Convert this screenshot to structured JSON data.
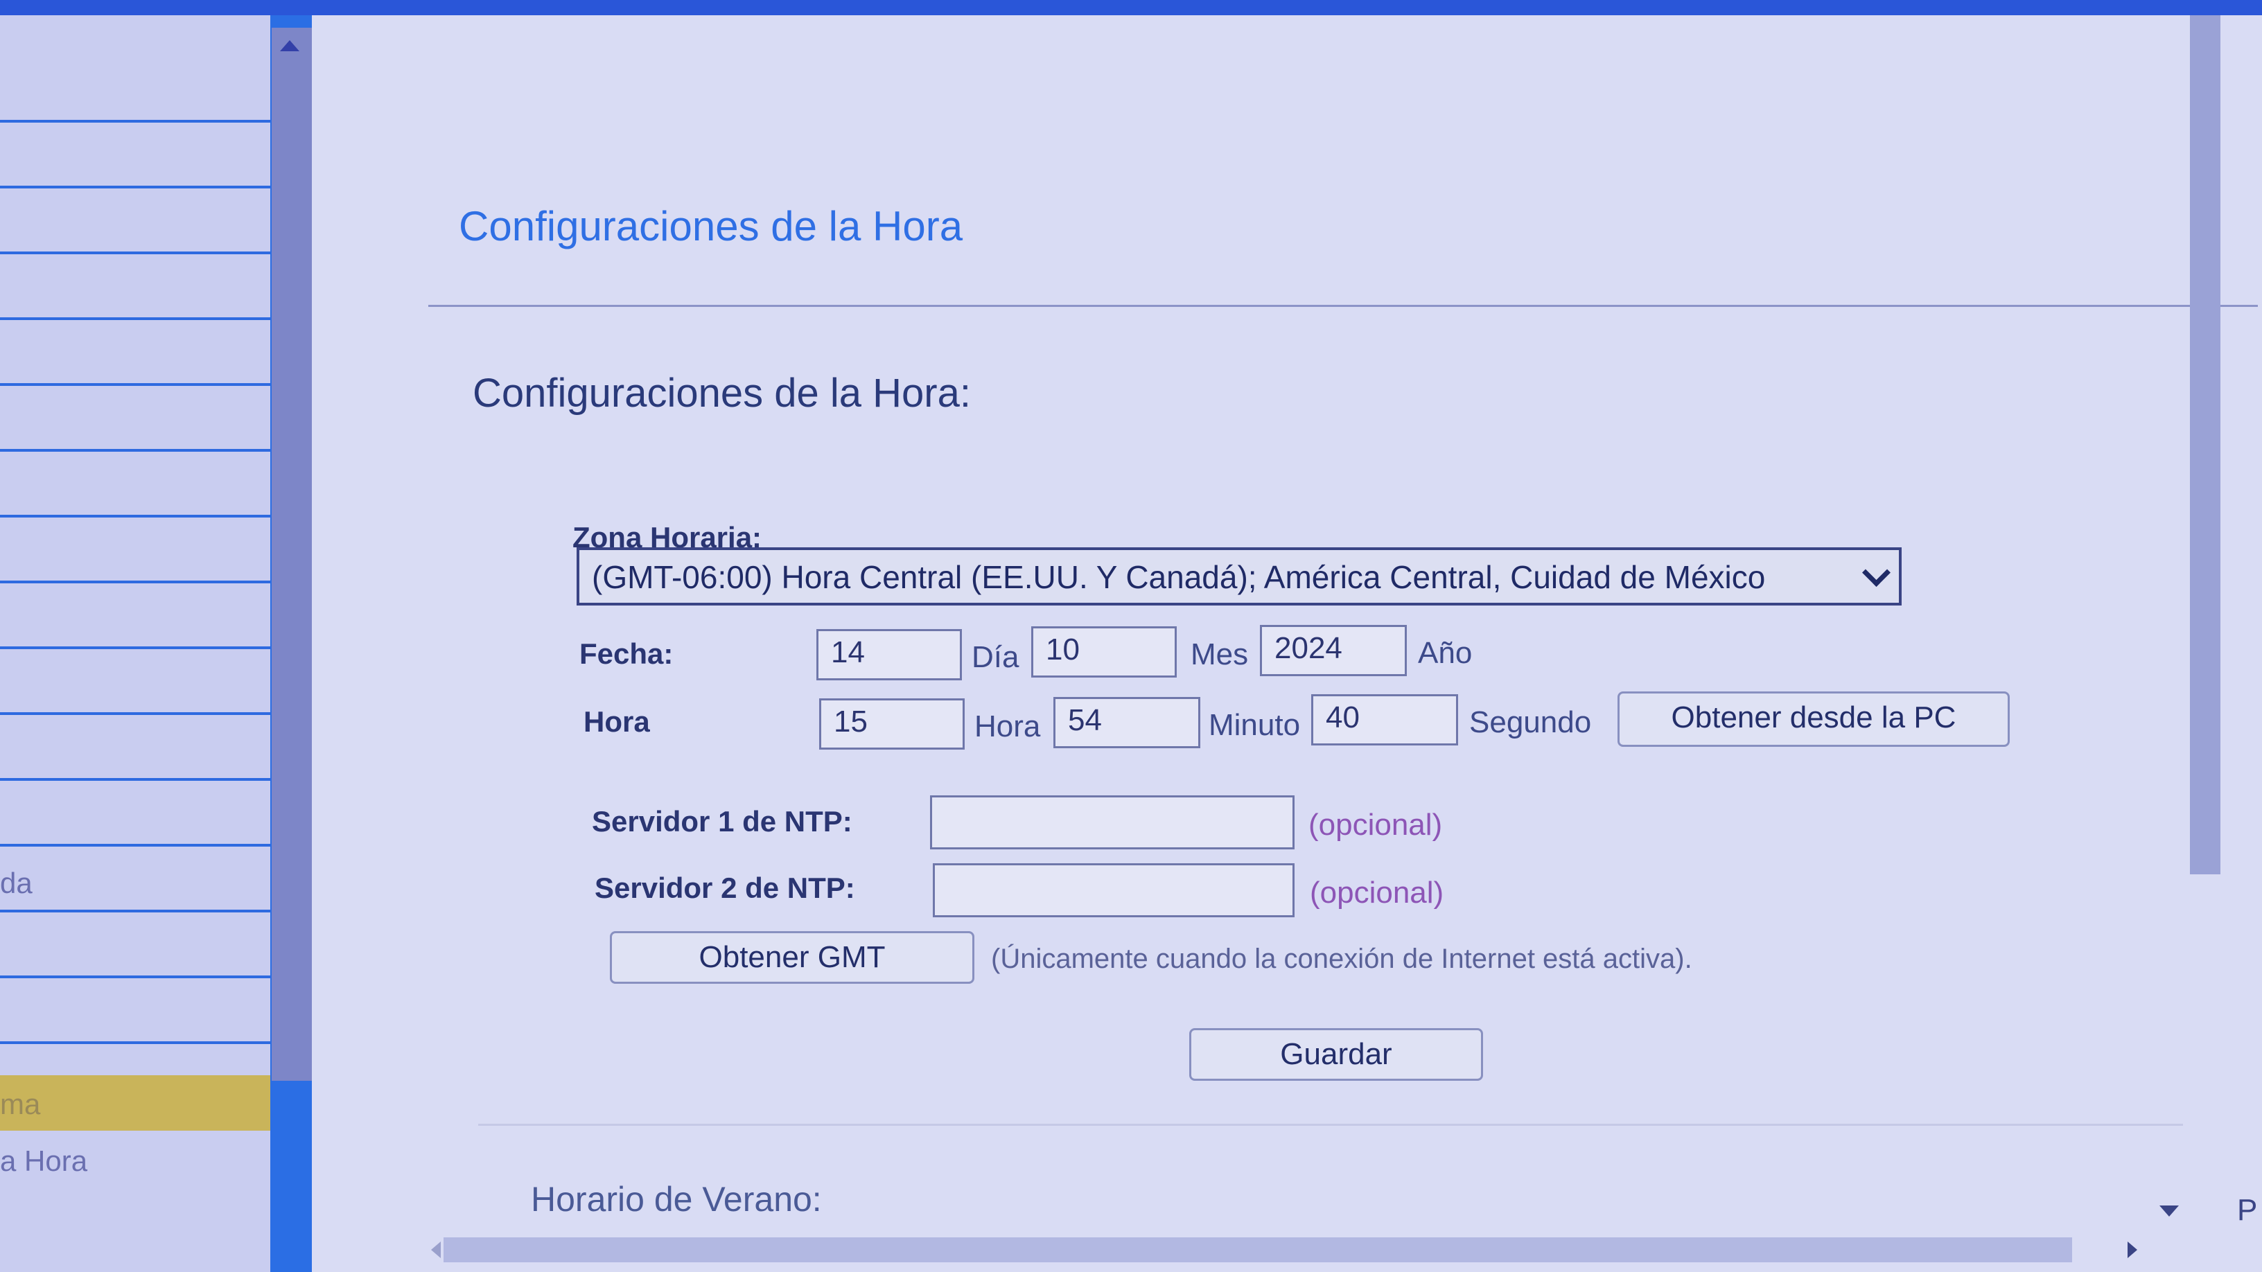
{
  "sidebar": {
    "items": [
      {
        "label": ""
      },
      {
        "label": ""
      },
      {
        "label": ""
      },
      {
        "label": ""
      },
      {
        "label": ""
      },
      {
        "label": ""
      },
      {
        "label": ""
      },
      {
        "label": ""
      },
      {
        "label": ""
      },
      {
        "label": ""
      },
      {
        "label": ""
      },
      {
        "label": ""
      },
      {
        "label": "da"
      },
      {
        "label": ""
      },
      {
        "label": ""
      },
      {
        "label": ""
      },
      {
        "label": "ma"
      },
      {
        "label": "a Hora"
      }
    ]
  },
  "page": {
    "title": "Configuraciones de la Hora",
    "section_title": "Configuraciones de la Hora:"
  },
  "timezone": {
    "label": "Zona Horaria:",
    "value": "(GMT-06:00) Hora Central (EE.UU. Y Canadá); América Central, Cuidad de México"
  },
  "date": {
    "label": "Fecha:",
    "day": "14",
    "day_unit": "Día",
    "month": "10",
    "month_unit": "Mes",
    "year": "2024",
    "year_unit": "Año"
  },
  "time": {
    "label": "Hora",
    "hour": "15",
    "hour_unit": "Hora",
    "minute": "54",
    "minute_unit": "Minuto",
    "second": "40",
    "second_unit": "Segundo",
    "get_from_pc_label": "Obtener desde la PC"
  },
  "ntp": {
    "server1_label": "Servidor 1 de NTP:",
    "server1_value": "",
    "server1_hint": "(opcional)",
    "server2_label": "Servidor 2 de NTP:",
    "server2_value": "",
    "server2_hint": "(opcional)",
    "get_gmt_label": "Obtener GMT",
    "get_gmt_note": "(Únicamente cuando la conexión de Internet está activa)."
  },
  "save_label": "Guardar",
  "dst": {
    "title": "Horario de Verano:"
  },
  "corner_text": "P",
  "colors": {
    "accent_blue": "#2f6fe4",
    "frame_blue": "#2b6ee4",
    "active_item": "#c9b45a",
    "hint_purple": "#8d55b6"
  }
}
